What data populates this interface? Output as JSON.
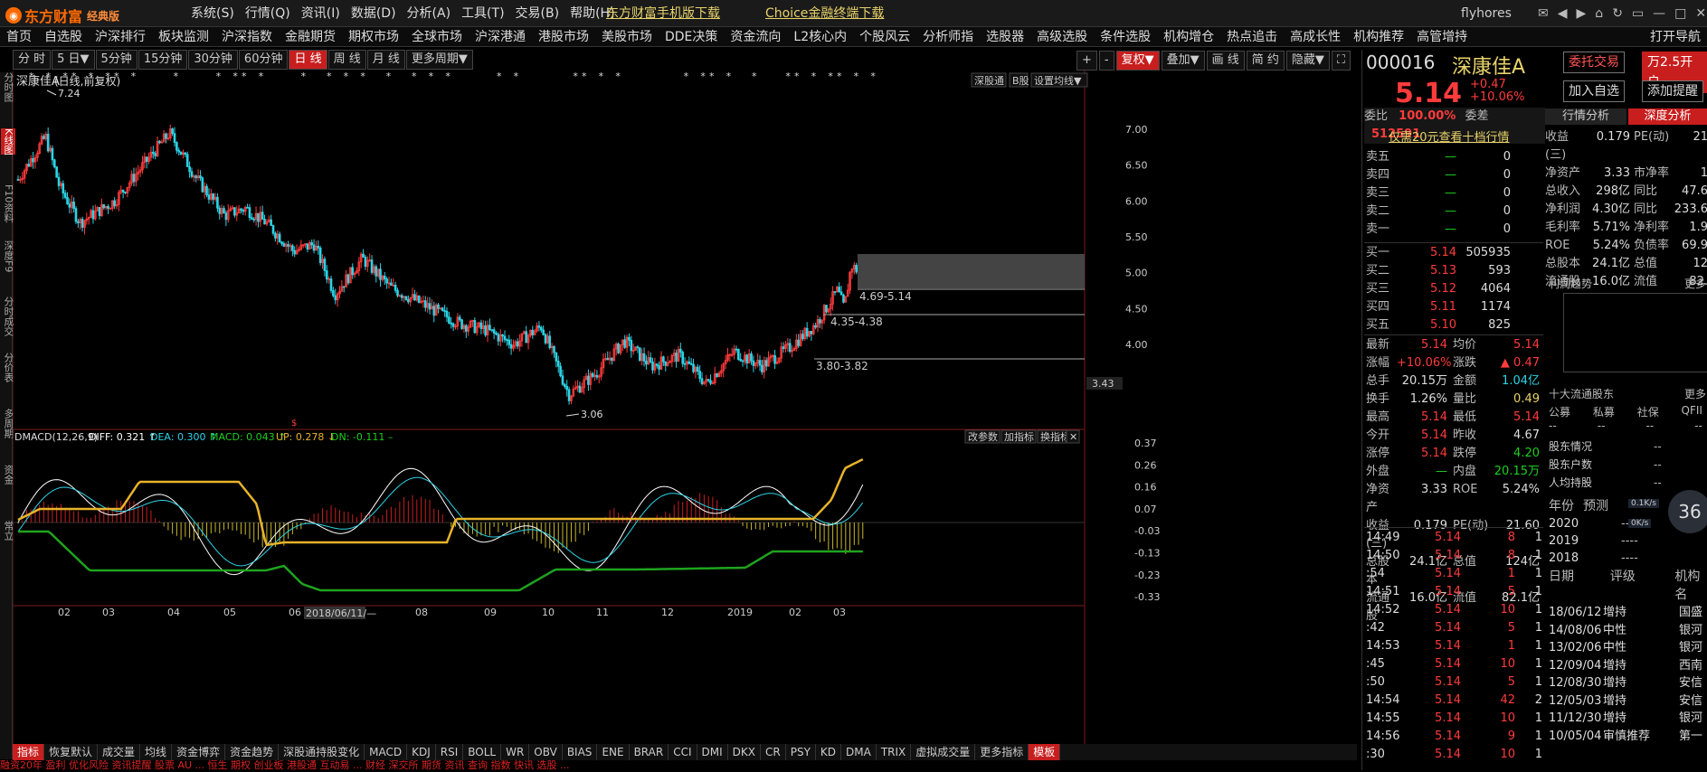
{
  "app": {
    "brand": "东方财富",
    "edition": "经典版",
    "user": "flyhores"
  },
  "menu": [
    "系统(S)",
    "行情(Q)",
    "资讯(I)",
    "数据(D)",
    "分析(A)",
    "工具(T)",
    "交易(B)",
    "帮助(H)"
  ],
  "links": [
    "东方财富手机版下载",
    "Choice金融终端下载"
  ],
  "nav": [
    "首页",
    "自选股",
    "沪深排行",
    "板块监测",
    "沪深指数",
    "金融期货",
    "期权市场",
    "全球市场",
    "沪深港通",
    "港股市场",
    "美股市场",
    "DDE决策",
    "资金流向",
    "L2核心内",
    "个股风云",
    "分析师指",
    "选股器",
    "高级选股",
    "条件选股",
    "机构增仓",
    "热点追击",
    "高成长性",
    "机构推荐",
    "高管增持",
    "打开导航"
  ],
  "periods": [
    "分 时",
    "5 日▼",
    "5分钟",
    "15分钟",
    "30分钟",
    "60分钟",
    "日 线",
    "周 线",
    "月 线",
    "更多周期▼"
  ],
  "active_period": "日 线",
  "left_tabs": [
    "分时图",
    "K线图",
    "F10资料",
    "深度F9",
    "分时成交",
    "分价表",
    "多周期",
    "资金",
    "常立"
  ],
  "chart_tools": [
    "+",
    "-",
    "复权▼",
    "叠加▼",
    "画 线",
    "简 约",
    "隐藏▼",
    "⛶"
  ],
  "chart": {
    "title": "深康佳A",
    "subtitle": "(日线,前复权)",
    "right_tags": [
      "深股通",
      "B股",
      "设置均线▼"
    ],
    "hi_label": "7.24",
    "lo_label": "3.06",
    "current_tag": "3.43",
    "ranges": [
      "4.69-5.14",
      "4.35-4.38",
      "3.80-3.82"
    ],
    "date_tag": "2018/06/11/—",
    "yticks": [
      "7.00",
      "6.50",
      "6.00",
      "5.50",
      "5.00",
      "4.50",
      "4.00"
    ],
    "xticks": [
      "02",
      "03",
      "04",
      "05",
      "06",
      "07",
      "08",
      "09",
      "10",
      "11",
      "12",
      "2019",
      "02",
      "03"
    ]
  },
  "macd": {
    "label": "DMACD(12,26,9)",
    "diff": "DIFF: 0.321 ↑",
    "dea": "DEA: 0.300 ↑",
    "macd": "MACD: 0.043 ↑",
    "up": "UP: 0.278 ↓",
    "dn": "DN: -0.111 –",
    "buttons": [
      "改参数",
      "加指标",
      "换指标",
      "✕"
    ],
    "yticks": [
      "0.37",
      "0.26",
      "0.16",
      "0.07",
      "-0.03",
      "-0.13",
      "-0.23",
      "-0.33"
    ]
  },
  "indicators": [
    "指标",
    "恢复默认",
    "成交量",
    "均线",
    "资金博弈",
    "资金趋势",
    "深股通持股变化",
    "MACD",
    "KDJ",
    "RSI",
    "BOLL",
    "WR",
    "OBV",
    "BIAS",
    "ENE",
    "BRAR",
    "CCI",
    "DMI",
    "DKX",
    "CR",
    "PSY",
    "KD",
    "DMA",
    "TRIX",
    "虚拟成交量",
    "更多指标",
    "模板"
  ],
  "status": "融资20年 盈利 优化风险 资讯提醒 股票 AU ... 恒生 期权 创业板 港股通 互动易 ... 财经 深交所 期货 资讯 查询 指数 快讯 选股 ...",
  "stock": {
    "code": "000016",
    "name": "深康佳A",
    "price": "5.14",
    "change": "+0.47",
    "pct": "+10.06%",
    "btn_trade": "委托交易",
    "btn_open": "万2.5开户",
    "btn_add": "加入自选",
    "btn_alert": "添加提醒"
  },
  "orderbook": {
    "wb_label": "委比",
    "wb": "100.00%",
    "wc_label": "委差",
    "wc": "512591",
    "promo": "仅需20元查看十档行情",
    "sells": [
      [
        "卖五",
        "—",
        "0"
      ],
      [
        "卖四",
        "—",
        "0"
      ],
      [
        "卖三",
        "—",
        "0"
      ],
      [
        "卖二",
        "—",
        "0"
      ],
      [
        "卖一",
        "—",
        "0"
      ]
    ],
    "buys": [
      [
        "买一",
        "5.14",
        "505935"
      ],
      [
        "买二",
        "5.13",
        "593"
      ],
      [
        "买三",
        "5.12",
        "4064"
      ],
      [
        "买四",
        "5.11",
        "1174"
      ],
      [
        "买五",
        "5.10",
        "825"
      ]
    ]
  },
  "quote": [
    [
      "最新",
      "5.14",
      "均价",
      "5.14"
    ],
    [
      "涨幅",
      "+10.06%",
      "涨跌",
      "▲ 0.47"
    ],
    [
      "总手",
      "20.15万",
      "金额",
      "1.04亿"
    ],
    [
      "换手",
      "1.26%",
      "量比",
      "0.49"
    ],
    [
      "最高",
      "5.14",
      "最低",
      "5.14"
    ],
    [
      "今开",
      "5.14",
      "昨收",
      "4.67"
    ],
    [
      "涨停",
      "5.14",
      "跌停",
      "4.20"
    ],
    [
      "外盘",
      "—",
      "内盘",
      "20.15万"
    ],
    [
      "净资产",
      "3.33",
      "ROE",
      "5.24%"
    ],
    [
      "收益(三)",
      "0.179",
      "PE(动)",
      "21.60"
    ],
    [
      "总股本",
      "24.1亿",
      "总值",
      "124亿"
    ],
    [
      "流通股",
      "16.0亿",
      "流值",
      "82.1亿"
    ]
  ],
  "ticks": [
    [
      "14:49",
      "5.14",
      "8",
      "1"
    ],
    [
      "14:50",
      "5.14",
      "8",
      "1"
    ],
    [
      ":54",
      "5.14",
      "1",
      "1"
    ],
    [
      "14:51",
      "5.14",
      "5",
      "1"
    ],
    [
      "14:52",
      "5.14",
      "10",
      "1"
    ],
    [
      ":42",
      "5.14",
      "5",
      "1"
    ],
    [
      "14:53",
      "5.14",
      "1",
      "1"
    ],
    [
      ":45",
      "5.14",
      "10",
      "1"
    ],
    [
      ":50",
      "5.14",
      "5",
      "1"
    ],
    [
      "14:54",
      "5.14",
      "42",
      "2"
    ],
    [
      "14:55",
      "5.14",
      "10",
      "1"
    ],
    [
      "14:56",
      "5.14",
      "9",
      "1"
    ],
    [
      ":30",
      "5.14",
      "10",
      "1"
    ]
  ],
  "right_tabs": [
    "行情分析",
    "深度分析"
  ],
  "fin": [
    [
      "收益(三)",
      "0.179",
      "PE(动)",
      "21"
    ],
    [
      "净资产",
      "3.33",
      "市净率",
      "1"
    ],
    [
      "总收入",
      "298亿",
      "同比",
      "47.6"
    ],
    [
      "净利润",
      "4.30亿",
      "同比",
      "233.6"
    ],
    [
      "毛利率",
      "5.71%",
      "净利率",
      "1.9"
    ],
    [
      "ROE",
      "5.24%",
      "负债率",
      "69.9"
    ],
    [
      "总股本",
      "24.1亿",
      "总值",
      "12"
    ],
    [
      "流通股",
      "16.0亿",
      "流值",
      "82."
    ]
  ],
  "profit_trend": "利润趋势",
  "more": "更多",
  "holders": {
    "title": "十大流通股东",
    "cols": [
      "公募",
      "私募",
      "社保",
      "QFII"
    ],
    "vals": [
      "--",
      "--",
      "--",
      "--"
    ],
    "rows": [
      [
        "股东情况",
        "--"
      ],
      [
        "股东户数",
        "--"
      ],
      [
        "人均持股",
        "--"
      ]
    ]
  },
  "forecast": {
    "hdr": [
      "年份",
      "预测"
    ],
    "rows": [
      [
        "2020",
        "----"
      ],
      [
        "2019",
        "----"
      ],
      [
        "2018",
        "----"
      ]
    ],
    "speed": [
      "0.1K/s",
      "0K/s"
    ],
    "circle": "36"
  },
  "ratings": {
    "hdr": [
      "日期",
      "评级",
      "机构名"
    ],
    "rows": [
      [
        "18/06/12",
        "增持",
        "国盛"
      ],
      [
        "14/08/06",
        "中性",
        "银河"
      ],
      [
        "13/02/06",
        "中性",
        "银河"
      ],
      [
        "12/09/04",
        "增持",
        "西南"
      ],
      [
        "12/08/30",
        "增持",
        "安信"
      ],
      [
        "12/05/03",
        "增持",
        "安信"
      ],
      [
        "11/12/30",
        "增持",
        "银河"
      ],
      [
        "10/05/04",
        "审慎推荐",
        "第一"
      ]
    ]
  },
  "colors": {
    "up": "#ff3b3b",
    "down": "#2cd4e6",
    "accent": "#c81e1e",
    "yellow": "#e8d36a"
  }
}
